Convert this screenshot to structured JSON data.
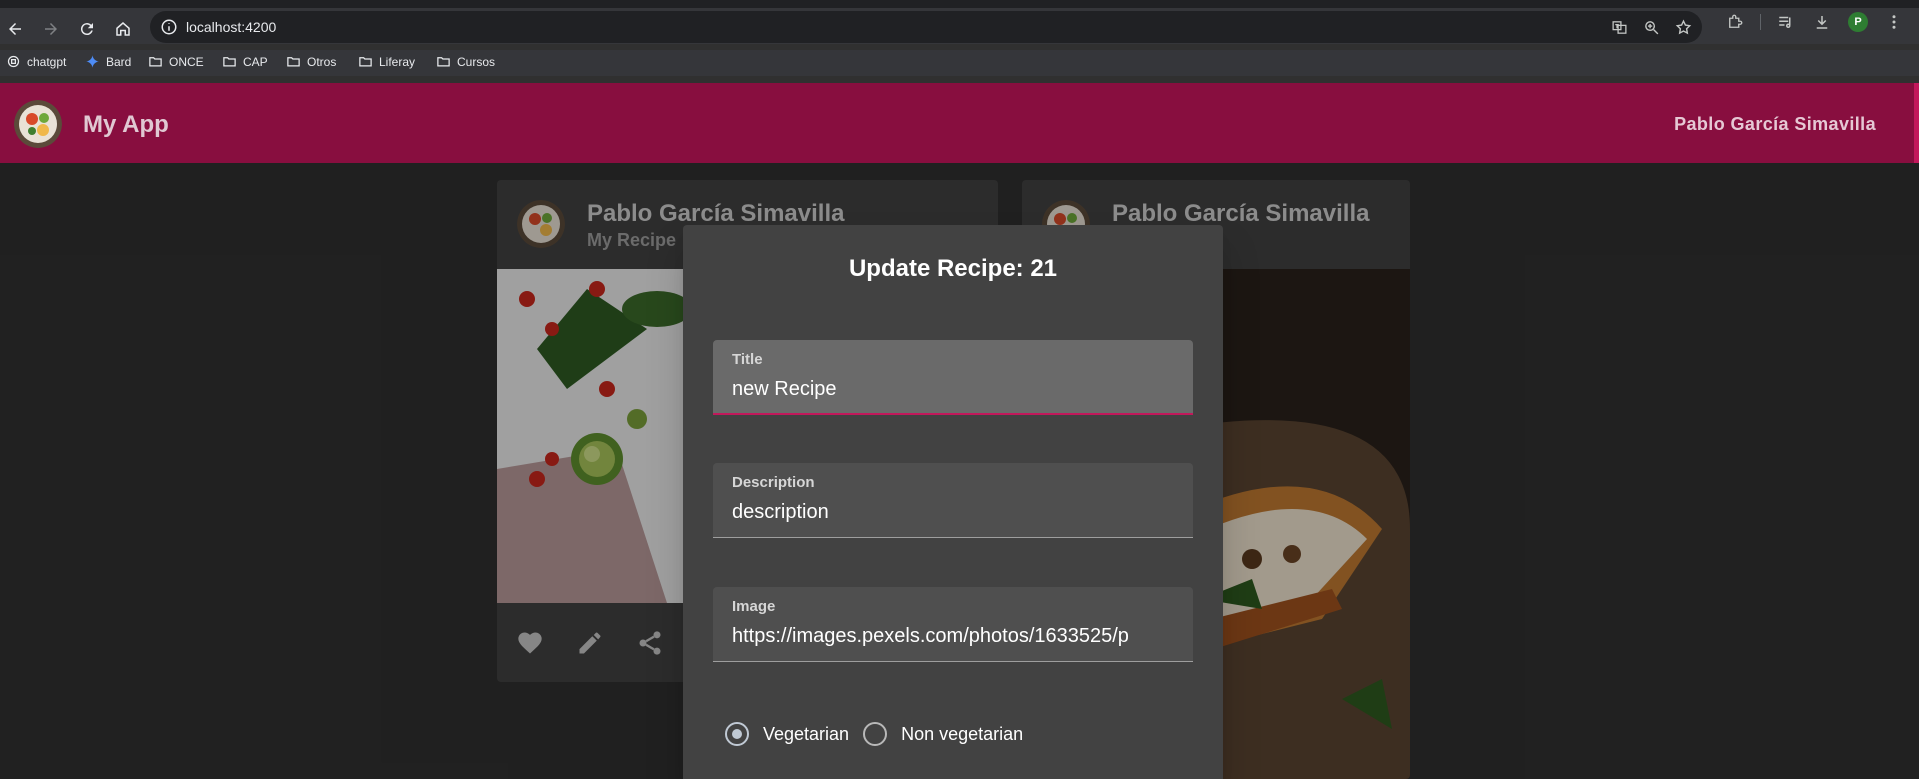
{
  "browser": {
    "url": "localhost:4200",
    "bookmarks": [
      {
        "label": "chatgpt",
        "icon": "chatgpt-icon"
      },
      {
        "label": "Bard",
        "icon": "bard-sparkle-icon"
      },
      {
        "label": "ONCE",
        "icon": "folder-icon"
      },
      {
        "label": "CAP",
        "icon": "folder-icon"
      },
      {
        "label": "Otros",
        "icon": "folder-icon"
      },
      {
        "label": "Liferay",
        "icon": "folder-icon"
      },
      {
        "label": "Cursos",
        "icon": "folder-icon"
      }
    ],
    "profile_initial": "P"
  },
  "app": {
    "title": "My App",
    "user": "Pablo García Simavilla"
  },
  "cards": [
    {
      "title": "Pablo García Simavilla",
      "subtitle": "My Recipe",
      "image": "vegetables-photo"
    },
    {
      "title": "Pablo García Simavilla",
      "subtitle": "",
      "image": "sandwich-photo"
    }
  ],
  "dialog": {
    "title": "Update Recipe: 21",
    "fields": {
      "title": {
        "label": "Title",
        "value": "new Recipe"
      },
      "description": {
        "label": "Description",
        "value": "description"
      },
      "image": {
        "label": "Image",
        "value": "https://images.pexels.com/photos/1633525/p"
      }
    },
    "radio": {
      "options": [
        "Vegetarian",
        "Non vegetarian"
      ],
      "selected": "Vegetarian"
    }
  },
  "colors": {
    "header": "#880e3f",
    "accent": "#c2185b",
    "background": "#303030",
    "card": "#424242"
  }
}
